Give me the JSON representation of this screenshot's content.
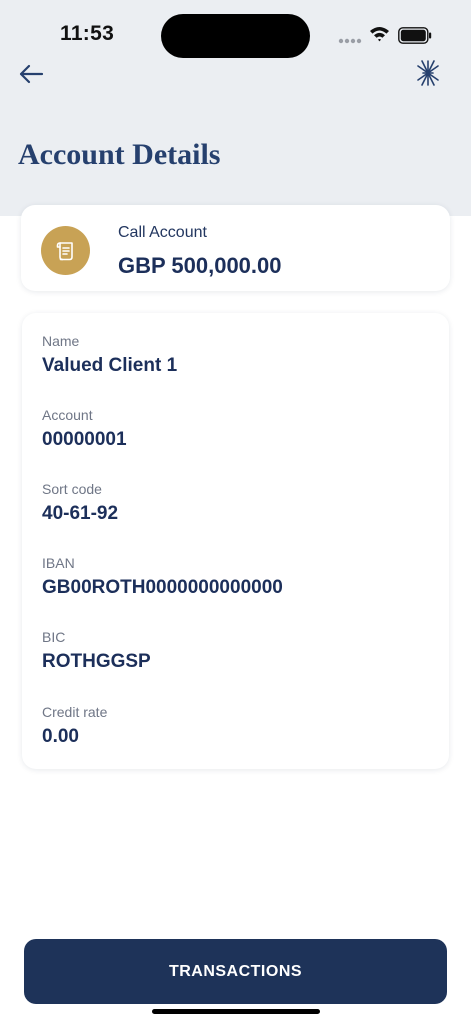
{
  "status_bar": {
    "time": "11:53"
  },
  "header": {
    "back_icon": "arrow-left-icon",
    "brand_icon": "starburst-logo-icon",
    "title": "Account Details"
  },
  "account": {
    "icon": "scroll-icon",
    "type": "Call Account",
    "balance": "GBP 500,000.00"
  },
  "details": [
    {
      "label": "Name",
      "value": "Valued Client 1"
    },
    {
      "label": "Account",
      "value": "00000001"
    },
    {
      "label": "Sort code",
      "value": "40-61-92"
    },
    {
      "label": "IBAN",
      "value": "GB00ROTH0000000000000"
    },
    {
      "label": "BIC",
      "value": "ROTHGGSP"
    },
    {
      "label": "Credit rate",
      "value": "0.00"
    }
  ],
  "footer": {
    "transactions_label": "TRANSACTIONS"
  },
  "colors": {
    "navy": "#1e3359",
    "gold": "#c8a255",
    "header_bg": "#ebeef2"
  }
}
